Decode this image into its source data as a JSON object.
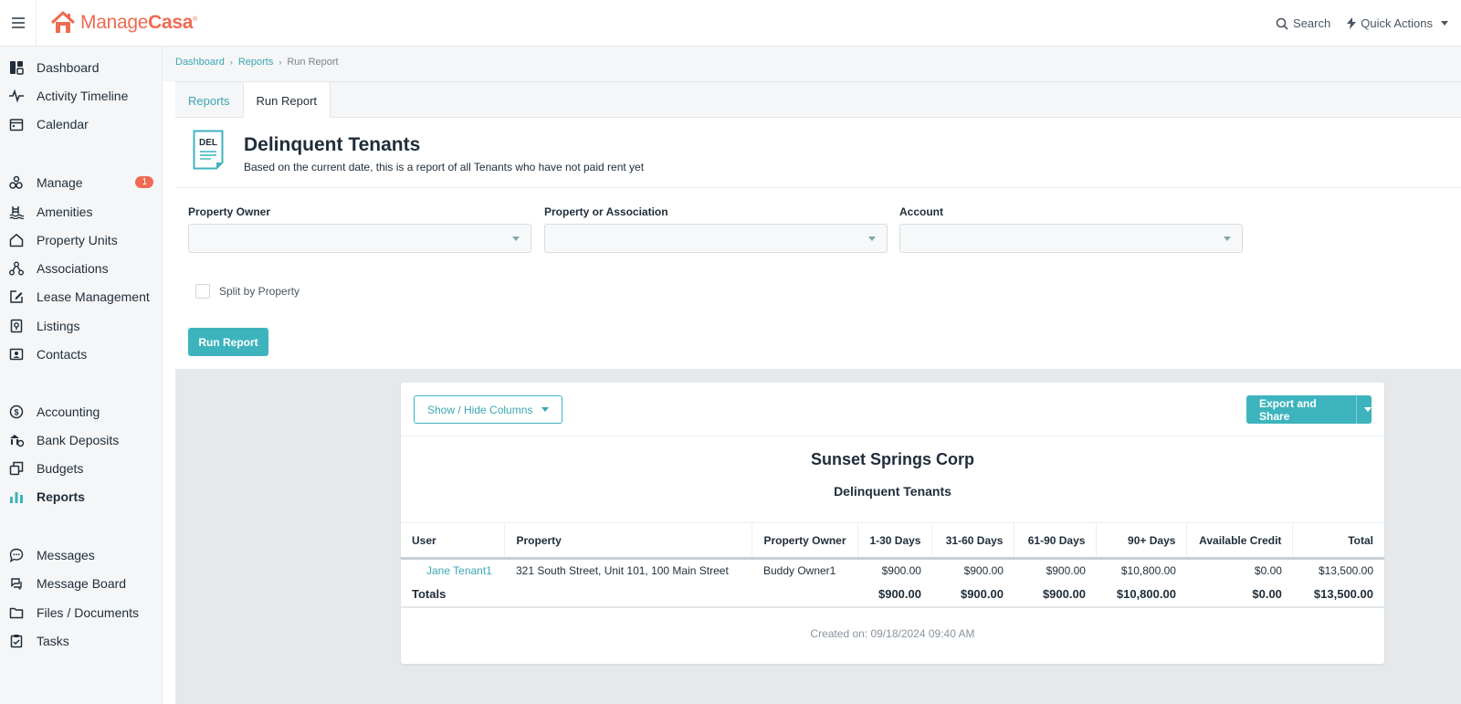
{
  "app": {
    "logo_prefix": "Manage",
    "logo_suffix": "Casa",
    "logo_mark": "®",
    "brand_color": "#ef6a52",
    "accent_color": "#3db4bd"
  },
  "topbar": {
    "search_label": "Search",
    "quick_actions_label": "Quick Actions"
  },
  "sidebar": {
    "items": [
      {
        "label": "Dashboard",
        "icon": "dashboard-icon"
      },
      {
        "label": "Activity Timeline",
        "icon": "pulse-icon"
      },
      {
        "label": "Calendar",
        "icon": "calendar-icon"
      },
      {
        "label": "Manage",
        "icon": "manage-icon",
        "badge": "1"
      },
      {
        "label": "Amenities",
        "icon": "pool-icon"
      },
      {
        "label": "Property Units",
        "icon": "house-icon"
      },
      {
        "label": "Associations",
        "icon": "network-icon"
      },
      {
        "label": "Lease Management",
        "icon": "edit-document-icon"
      },
      {
        "label": "Listings",
        "icon": "listing-icon"
      },
      {
        "label": "Contacts",
        "icon": "contact-card-icon"
      },
      {
        "label": "Accounting",
        "icon": "dollar-icon"
      },
      {
        "label": "Bank Deposits",
        "icon": "bank-deposit-icon"
      },
      {
        "label": "Budgets",
        "icon": "budget-icon"
      },
      {
        "label": "Reports",
        "icon": "bar-chart-icon",
        "active": true
      },
      {
        "label": "Messages",
        "icon": "chat-bubble-icon"
      },
      {
        "label": "Message Board",
        "icon": "message-board-icon"
      },
      {
        "label": "Files / Documents",
        "icon": "folder-icon"
      },
      {
        "label": "Tasks",
        "icon": "clipboard-check-icon"
      }
    ]
  },
  "breadcrumb": {
    "items": [
      "Dashboard",
      "Reports"
    ],
    "current": "Run Report"
  },
  "tabs": {
    "reports": "Reports",
    "run_report": "Run Report"
  },
  "report": {
    "icon_text": "DEL",
    "title": "Delinquent Tenants",
    "description": "Based on the current date, this is a report of all Tenants who have not paid rent yet"
  },
  "filters": {
    "property_owner_label": "Property Owner",
    "property_owner_value": "",
    "property_label": "Property or Association",
    "property_value": "",
    "account_label": "Account",
    "account_value": "",
    "split_by_property_label": "Split by Property",
    "split_by_property_checked": false,
    "run_button": "Run Report"
  },
  "results": {
    "show_hide_label": "Show / Hide Columns",
    "export_label": "Export and Share",
    "company": "Sunset Springs Corp",
    "report_name": "Delinquent Tenants",
    "columns": [
      "User",
      "Property",
      "Property Owner",
      "1-30 Days",
      "31-60 Days",
      "61-90 Days",
      "90+ Days",
      "Available Credit",
      "Total"
    ],
    "rows": [
      {
        "user": "Jane Tenant1",
        "property": "321 South Street, Unit 101, 100 Main Street",
        "owner": "Buddy Owner1",
        "d1_30": "$900.00",
        "d31_60": "$900.00",
        "d61_90": "$900.00",
        "d90_plus": "$10,800.00",
        "credit": "$0.00",
        "total": "$13,500.00"
      }
    ],
    "totals": {
      "label": "Totals",
      "d1_30": "$900.00",
      "d31_60": "$900.00",
      "d61_90": "$900.00",
      "d90_plus": "$10,800.00",
      "credit": "$0.00",
      "total": "$13,500.00"
    },
    "created_on": "Created on: 09/18/2024 09:40 AM"
  }
}
